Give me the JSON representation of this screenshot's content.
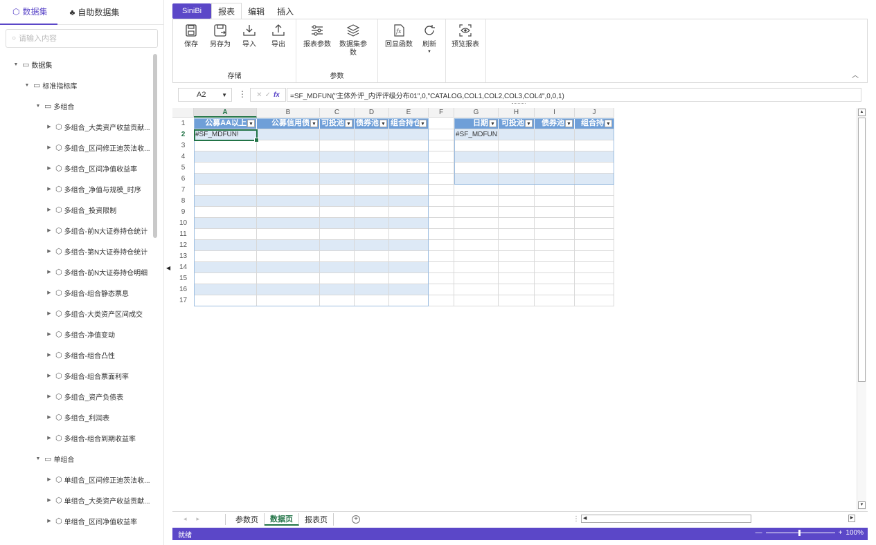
{
  "left_panel": {
    "tabs": [
      {
        "icon": "cube-icon",
        "label": "数据集"
      },
      {
        "icon": "org-tree-icon",
        "label": "自助数据集"
      }
    ],
    "search_placeholder": "请输入内容",
    "tree": [
      {
        "label": "数据集",
        "level": 0,
        "type": "folder",
        "expanded": true
      },
      {
        "label": "标准指标库",
        "level": 1,
        "type": "folder",
        "expanded": true
      },
      {
        "label": "多组合",
        "level": 2,
        "type": "folder",
        "expanded": true
      },
      {
        "label": "多组合_大类资产收益贡献...",
        "level": 3,
        "type": "dataset"
      },
      {
        "label": "多组合_区间修正迪茨法收...",
        "level": 3,
        "type": "dataset"
      },
      {
        "label": "多组合_区间净值收益率",
        "level": 3,
        "type": "dataset"
      },
      {
        "label": "多组合_净值与规模_时序",
        "level": 3,
        "type": "dataset"
      },
      {
        "label": "多组合_投资限制",
        "level": 3,
        "type": "dataset"
      },
      {
        "label": "多组合-前N大证券持仓统计",
        "level": 3,
        "type": "dataset"
      },
      {
        "label": "多组合-第N大证券持仓统计",
        "level": 3,
        "type": "dataset"
      },
      {
        "label": "多组合-前N大证券持仓明细",
        "level": 3,
        "type": "dataset"
      },
      {
        "label": "多组合-组合静态票息",
        "level": 3,
        "type": "dataset"
      },
      {
        "label": "多组合-大类资产区间成交",
        "level": 3,
        "type": "dataset"
      },
      {
        "label": "多组合-净值变动",
        "level": 3,
        "type": "dataset"
      },
      {
        "label": "多组合-组合凸性",
        "level": 3,
        "type": "dataset"
      },
      {
        "label": "多组合-组合票面利率",
        "level": 3,
        "type": "dataset"
      },
      {
        "label": "多组合_资产负债表",
        "level": 3,
        "type": "dataset"
      },
      {
        "label": "多组合_利润表",
        "level": 3,
        "type": "dataset"
      },
      {
        "label": "多组合-组合到期收益率",
        "level": 3,
        "type": "dataset"
      },
      {
        "label": "单组合",
        "level": 2,
        "type": "folder",
        "expanded": true
      },
      {
        "label": "单组合_区间修正迪茨法收...",
        "level": 3,
        "type": "dataset"
      },
      {
        "label": "单组合_大类资产收益贡献...",
        "level": 3,
        "type": "dataset"
      },
      {
        "label": "单组合_区间净值收益率",
        "level": 3,
        "type": "dataset"
      }
    ]
  },
  "ribbon": {
    "brand": "SiniBi",
    "tabs": [
      "报表",
      "编辑",
      "插入"
    ],
    "active_tab": "报表",
    "groups": [
      {
        "label": "存储",
        "buttons": [
          {
            "icon": "save-icon",
            "label": "保存"
          },
          {
            "icon": "save-as-icon",
            "label": "另存为"
          },
          {
            "icon": "import-icon",
            "label": "导入"
          },
          {
            "icon": "export-icon",
            "label": "导出"
          }
        ]
      },
      {
        "label": "参数",
        "buttons": [
          {
            "icon": "sliders-icon",
            "label": "报表参数"
          },
          {
            "icon": "layers-icon",
            "label": "数据集参数"
          }
        ]
      },
      {
        "label": "",
        "buttons": [
          {
            "icon": "function-icon",
            "label": "回显函数"
          },
          {
            "icon": "refresh-icon",
            "label": "刷新"
          }
        ]
      },
      {
        "label": "",
        "buttons": [
          {
            "icon": "preview-icon",
            "label": "预览报表"
          }
        ]
      }
    ]
  },
  "formula_bar": {
    "cell_ref": "A2",
    "formula": "=SF_MDFUN(\"主体外评_内评评级分布01\",0,\"CATALOG,COL1,COL2,COL3,COL4\",0,0,1)"
  },
  "sheet": {
    "columns": [
      "A",
      "B",
      "C",
      "D",
      "E",
      "F",
      "G",
      "H",
      "I",
      "J"
    ],
    "rows": [
      "1",
      "2",
      "3",
      "4",
      "5",
      "6",
      "7",
      "8",
      "9",
      "10",
      "11",
      "12",
      "13",
      "14",
      "15",
      "16",
      "17"
    ],
    "table1_headers": [
      "公募AA以上",
      "公募信用债",
      "可投池",
      "债券池",
      "组合持仓"
    ],
    "table2_headers": [
      "日期",
      "可投池",
      "债券池",
      "组合持"
    ],
    "a2_value": "#SF_MDFUN!",
    "g2_value": "#SF_MDFUN!",
    "selected_cell": "A2"
  },
  "sheet_tabs": [
    "参数页",
    "数据页",
    "报表页"
  ],
  "active_sheet": "数据页",
  "status": {
    "text": "就绪",
    "zoom": "100%"
  },
  "colors": {
    "brand": "#5b47c8",
    "header_blue": "#6f9fd8",
    "band_blue": "#dde9f6",
    "selection_green": "#217346"
  }
}
